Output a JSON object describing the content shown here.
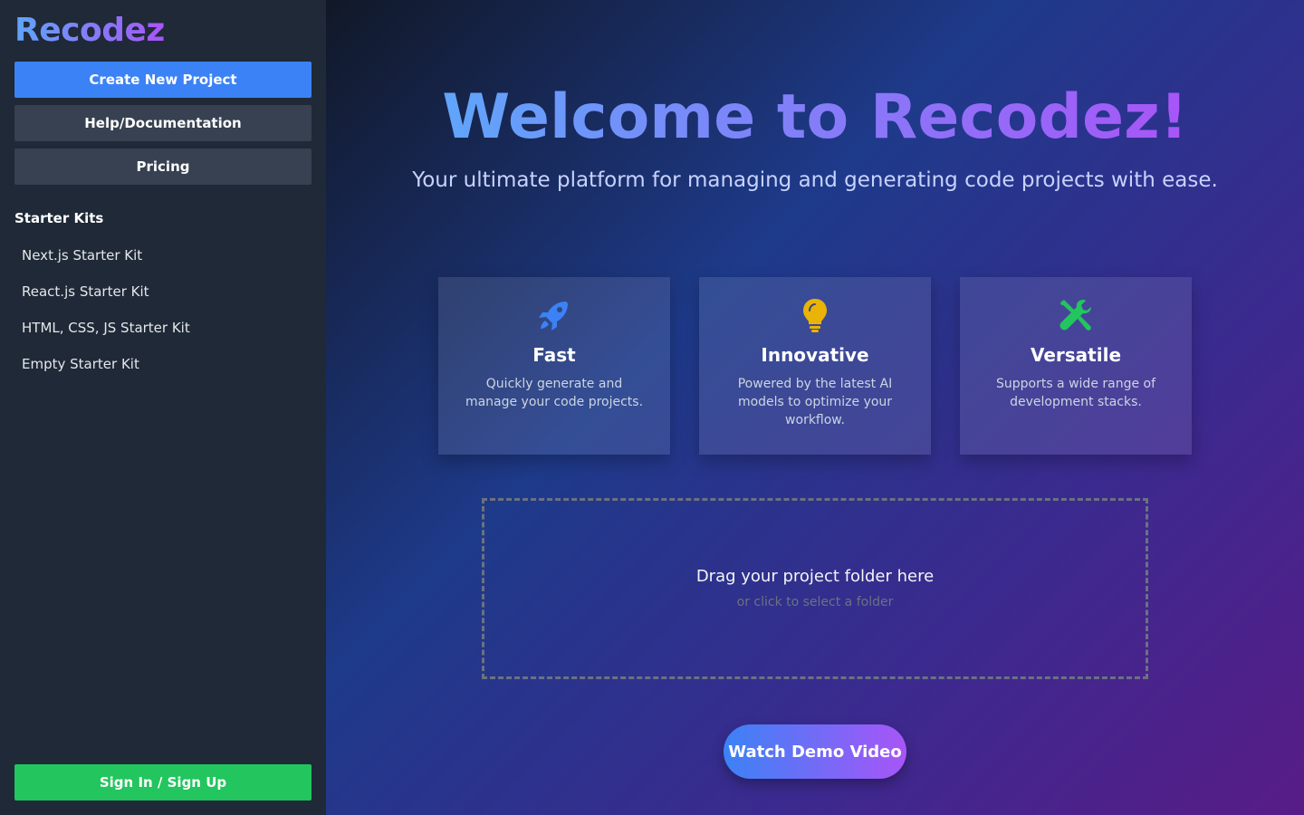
{
  "sidebar": {
    "logo": "Recodez",
    "buttons": {
      "create": "Create New Project",
      "help": "Help/Documentation",
      "pricing": "Pricing"
    },
    "section_title": "Starter Kits",
    "kits": [
      "Next.js Starter Kit",
      "React.js Starter Kit",
      "HTML, CSS, JS Starter Kit",
      "Empty Starter Kit"
    ],
    "signin": "Sign In / Sign Up"
  },
  "main": {
    "title": "Welcome to Recodez!",
    "subtitle": "Your ultimate platform for managing and generating code projects with ease.",
    "features": [
      {
        "icon": "rocket-icon",
        "title": "Fast",
        "desc": "Quickly generate and manage your code projects."
      },
      {
        "icon": "lightbulb-icon",
        "title": "Innovative",
        "desc": "Powered by the latest AI models to optimize your workflow."
      },
      {
        "icon": "tools-icon",
        "title": "Versatile",
        "desc": "Supports a wide range of development stacks."
      }
    ],
    "dropzone": {
      "main": "Drag your project folder here",
      "sub": "or click to select a folder"
    },
    "demo_button": "Watch Demo Video"
  },
  "colors": {
    "primary": "#3b82f6",
    "success": "#22c55e",
    "accent_purple": "#a855f7",
    "rocket": "#3b82f6",
    "bulb": "#eab308",
    "tools": "#22c55e"
  }
}
